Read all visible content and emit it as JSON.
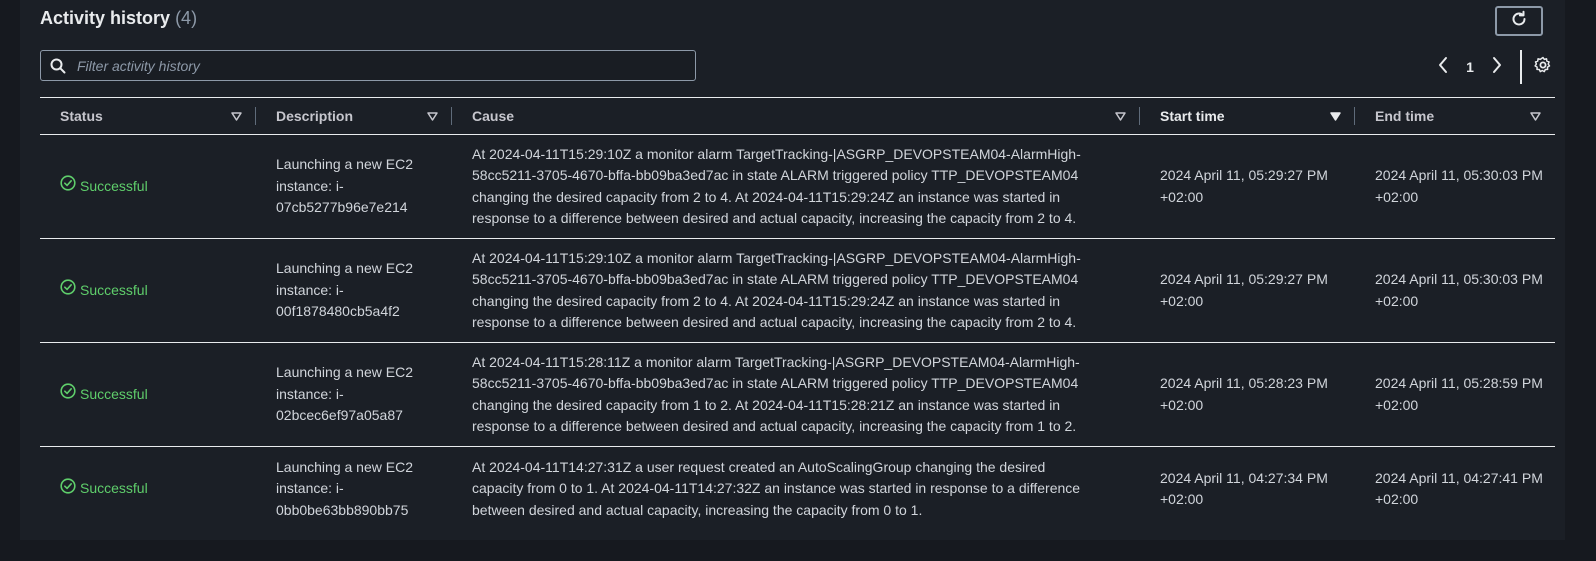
{
  "header": {
    "title": "Activity history",
    "count": "(4)"
  },
  "filter": {
    "placeholder": "Filter activity history",
    "value": ""
  },
  "pagination": {
    "current_page": "1"
  },
  "icons": {
    "search": "search-icon",
    "refresh": "refresh-icon",
    "prev": "chevron-left-icon",
    "next": "chevron-right-icon",
    "settings": "gear-icon",
    "sort": "caret-down-icon",
    "status": "check-circle-icon"
  },
  "colors": {
    "success": "#5fce6b",
    "border": "#e9ebed"
  },
  "columns": [
    "Status",
    "Description",
    "Cause",
    "Start time",
    "End time"
  ],
  "rows": [
    {
      "status": "Successful",
      "description": "Launching a new EC2 instance: i-07cb5277b96e7e214",
      "cause": "At 2024-04-11T15:29:10Z a monitor alarm TargetTracking-|ASGRP_DEVOPSTEAM04-AlarmHigh-58cc5211-3705-4670-bffa-bb09ba3ed7ac in state ALARM triggered policy TTP_DEVOPSTEAM04 changing the desired capacity from 2 to 4. At 2024-04-11T15:29:24Z an instance was started in response to a difference between desired and actual capacity, increasing the capacity from 2 to 4.",
      "start_time": "2024 April 11, 05:29:27 PM +02:00",
      "end_time": "2024 April 11, 05:30:03 PM +02:00"
    },
    {
      "status": "Successful",
      "description": "Launching a new EC2 instance: i-00f1878480cb5a4f2",
      "cause": "At 2024-04-11T15:29:10Z a monitor alarm TargetTracking-|ASGRP_DEVOPSTEAM04-AlarmHigh-58cc5211-3705-4670-bffa-bb09ba3ed7ac in state ALARM triggered policy TTP_DEVOPSTEAM04 changing the desired capacity from 2 to 4. At 2024-04-11T15:29:24Z an instance was started in response to a difference between desired and actual capacity, increasing the capacity from 2 to 4.",
      "start_time": "2024 April 11, 05:29:27 PM +02:00",
      "end_time": "2024 April 11, 05:30:03 PM +02:00"
    },
    {
      "status": "Successful",
      "description": "Launching a new EC2 instance: i-02bcec6ef97a05a87",
      "cause": "At 2024-04-11T15:28:11Z a monitor alarm TargetTracking-|ASGRP_DEVOPSTEAM04-AlarmHigh-58cc5211-3705-4670-bffa-bb09ba3ed7ac in state ALARM triggered policy TTP_DEVOPSTEAM04 changing the desired capacity from 1 to 2. At 2024-04-11T15:28:21Z an instance was started in response to a difference between desired and actual capacity, increasing the capacity from 1 to 2.",
      "start_time": "2024 April 11, 05:28:23 PM +02:00",
      "end_time": "2024 April 11, 05:28:59 PM +02:00"
    },
    {
      "status": "Successful",
      "description": "Launching a new EC2 instance: i-0bb0be63bb890bb75",
      "cause": "At 2024-04-11T14:27:31Z a user request created an AutoScalingGroup changing the desired capacity from 0 to 1. At 2024-04-11T14:27:32Z an instance was started in response to a difference between desired and actual capacity, increasing the capacity from 0 to 1.",
      "start_time": "2024 April 11, 04:27:34 PM +02:00",
      "end_time": "2024 April 11, 04:27:41 PM +02:00"
    }
  ]
}
